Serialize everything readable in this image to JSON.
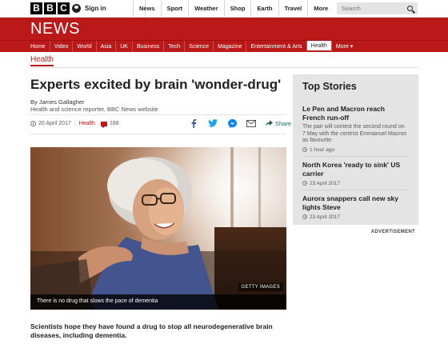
{
  "header": {
    "logo": [
      "B",
      "B",
      "C"
    ],
    "signin_label": "Sign in",
    "nav": [
      "News",
      "Sport",
      "Weather",
      "Shop",
      "Earth",
      "Travel"
    ],
    "more_label": "More",
    "search_placeholder": "Search"
  },
  "brand": {
    "title": "NEWS"
  },
  "subnav": {
    "items": [
      "Home",
      "Video",
      "World",
      "Asia",
      "UK",
      "Business",
      "Tech",
      "Science",
      "Magazine",
      "Entertainment & Arts",
      "Health"
    ],
    "active": "Health",
    "more_label": "More ▾"
  },
  "article": {
    "section": "Health",
    "headline": "Experts excited by brain 'wonder-drug'",
    "byline_name": "By James Gallagher",
    "byline_role": "Health and science reporter, BBC News website",
    "date": "20 April 2017",
    "section_link": "Health",
    "comment_count": "188",
    "share_label": "Share",
    "image_credit": "GETTY IMAGES",
    "image_caption": "There is no drug that slows the pace of dementia",
    "intro": "Scientists hope they have found a drug to stop all neurodegenerative brain diseases, including dementia."
  },
  "top_stories": {
    "heading": "Top Stories",
    "items": [
      {
        "title": "Le Pen and Macron reach French run-off",
        "summary": "The pair will contest the second round on 7 May with the centrist Emmanuel Macron as favourite.",
        "time": "1 hour ago"
      },
      {
        "title": "North Korea 'ready to sink' US carrier",
        "time": "23 April 2017"
      },
      {
        "title": "Aurora snappers call new sky lights Steve",
        "time": "23 April 2017"
      }
    ]
  },
  "advert_label": "ADVERTISEMENT",
  "colors": {
    "brand_red": "#bb1919",
    "share_green": "#1c6a54"
  },
  "icons": {
    "share": [
      "facebook-icon",
      "twitter-icon",
      "messenger-icon",
      "email-icon"
    ]
  }
}
